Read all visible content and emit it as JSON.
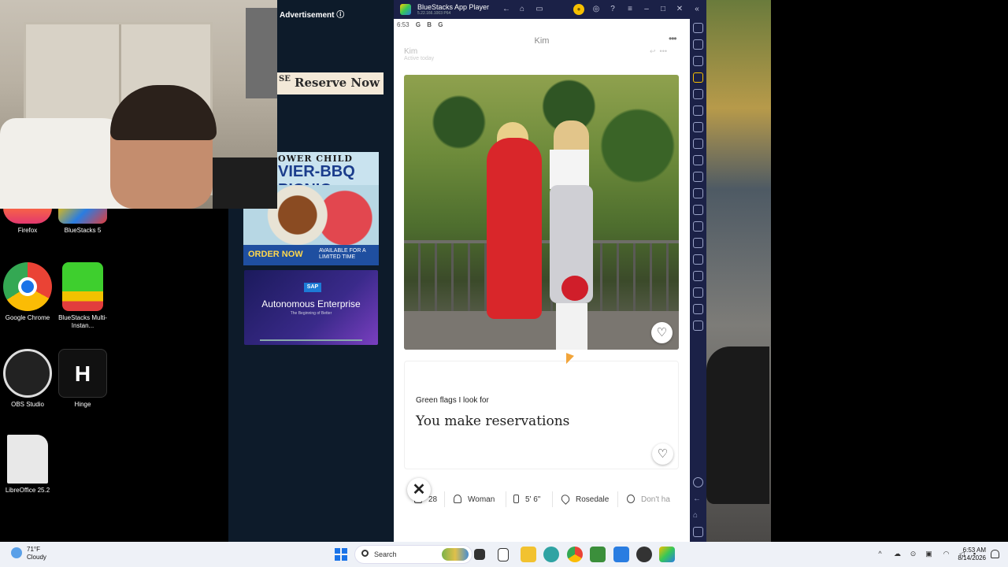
{
  "desktop": {
    "icons": [
      {
        "label": "Firefox"
      },
      {
        "label": "BlueStacks 5"
      },
      {
        "label": "Google Chrome"
      },
      {
        "label": "BlueStacks Multi-Instan..."
      },
      {
        "label": "OBS Studio"
      },
      {
        "label": "Hinge"
      },
      {
        "label": "LibreOffice 25.2"
      }
    ]
  },
  "ads": {
    "header": "Advertisement",
    "reserve": {
      "prefix": "SE",
      "label": "Reserve Now"
    },
    "bbq": {
      "line1": "OWER CHILD",
      "line2": "VIER-BBQ PICNIC",
      "cta": "ORDER NOW",
      "note": "AVAILABLE FOR A LIMITED TIME"
    },
    "sap": {
      "brand": "SAP",
      "title": "Autonomous Enterprise",
      "subtitle": "The Beginning of Better"
    }
  },
  "bluestacks": {
    "title": "BlueStacks App Player",
    "subtitle": "5.22.166.1003 P64"
  },
  "android": {
    "status_time": "6:53",
    "status_icons": [
      "G",
      "B",
      "G"
    ],
    "profile_name": "Kim",
    "ghost_name": "Kim",
    "ghost_sub": "Active today",
    "prompt": {
      "question": "Green flags I look for",
      "answer": "You make reservations"
    },
    "vitals": [
      {
        "icon": "cake-icon",
        "value": "28"
      },
      {
        "icon": "person-icon",
        "value": "Woman"
      },
      {
        "icon": "ruler-icon",
        "value": "5' 6\""
      },
      {
        "icon": "pin-icon",
        "value": "Rosedale"
      },
      {
        "icon": "kids-icon",
        "value": "Don't ha"
      }
    ]
  },
  "taskbar": {
    "weather_temp": "71°F",
    "weather_desc": "Cloudy",
    "search_label": "Search",
    "time": "6:53 AM",
    "date": "8/14/2026"
  }
}
